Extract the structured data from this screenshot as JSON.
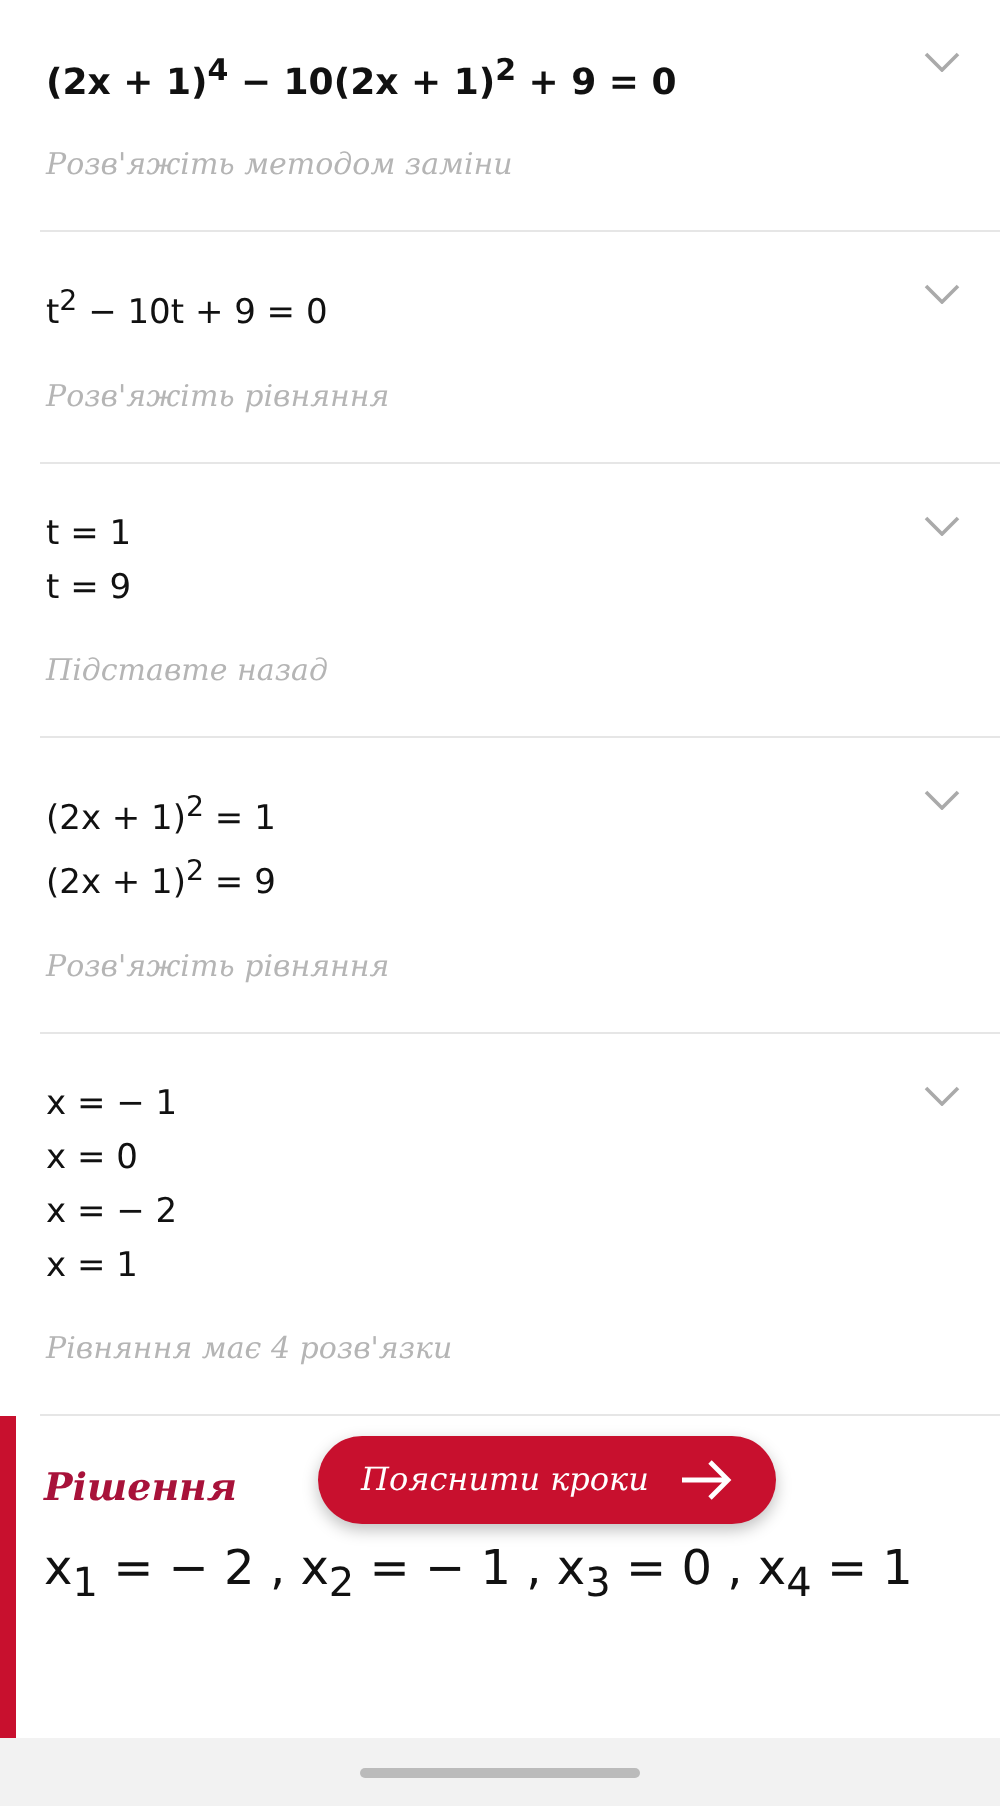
{
  "steps": [
    {
      "lines": [
        "(2x + 1)$^{4}$ − 10(2x + 1)$^{2}$ + 9 = 0"
      ],
      "bold": true,
      "hint": "Розв'яжіть методом заміни"
    },
    {
      "lines": [
        "t$^{2}$ − 10t + 9 = 0"
      ],
      "bold": false,
      "hint": "Розв'яжіть рівняння"
    },
    {
      "lines": [
        "t = 1",
        "t = 9"
      ],
      "bold": false,
      "hint": "Підставте назад"
    },
    {
      "lines": [
        "(2x + 1)$^{2}$ = 1",
        "(2x + 1)$^{2}$ = 9"
      ],
      "bold": false,
      "hint": "Розв'яжіть рівняння"
    },
    {
      "lines": [
        "x = − 1",
        "x = 0",
        "x = − 2",
        "x = 1"
      ],
      "bold": false,
      "hint": "Рівняння має 4 розв'язки"
    }
  ],
  "solution": {
    "title": "Рішення",
    "answer": "x$_{1}$ = − 2 , x$_{2}$ = − 1 , x$_{3}$ = 0 , x$_{4}$ = 1",
    "button": "Пояснити кроки"
  }
}
